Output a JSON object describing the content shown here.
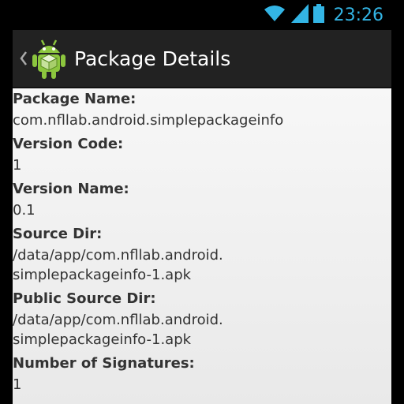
{
  "status_bar": {
    "time": "23:26",
    "icons": [
      "wifi-icon",
      "signal-icon",
      "battery-icon"
    ],
    "accent_color": "#33b5e5"
  },
  "action_bar": {
    "title": "Package Details",
    "icons": [
      "back-caret-icon",
      "android-package-icon"
    ]
  },
  "details": [
    {
      "label": "Package Name:",
      "value": "com.nfllab.android.simplepackageinfo"
    },
    {
      "label": "Version Code:",
      "value": "1"
    },
    {
      "label": "Version Name:",
      "value": "0.1"
    },
    {
      "label": "Source Dir:",
      "value": "/data/app/com.nfllab.android.\nsimplepackageinfo-1.apk"
    },
    {
      "label": "Public Source Dir:",
      "value": "/data/app/com.nfllab.android.\nsimplepackageinfo-1.apk"
    },
    {
      "label": "Number of Signatures:",
      "value": "1"
    }
  ]
}
